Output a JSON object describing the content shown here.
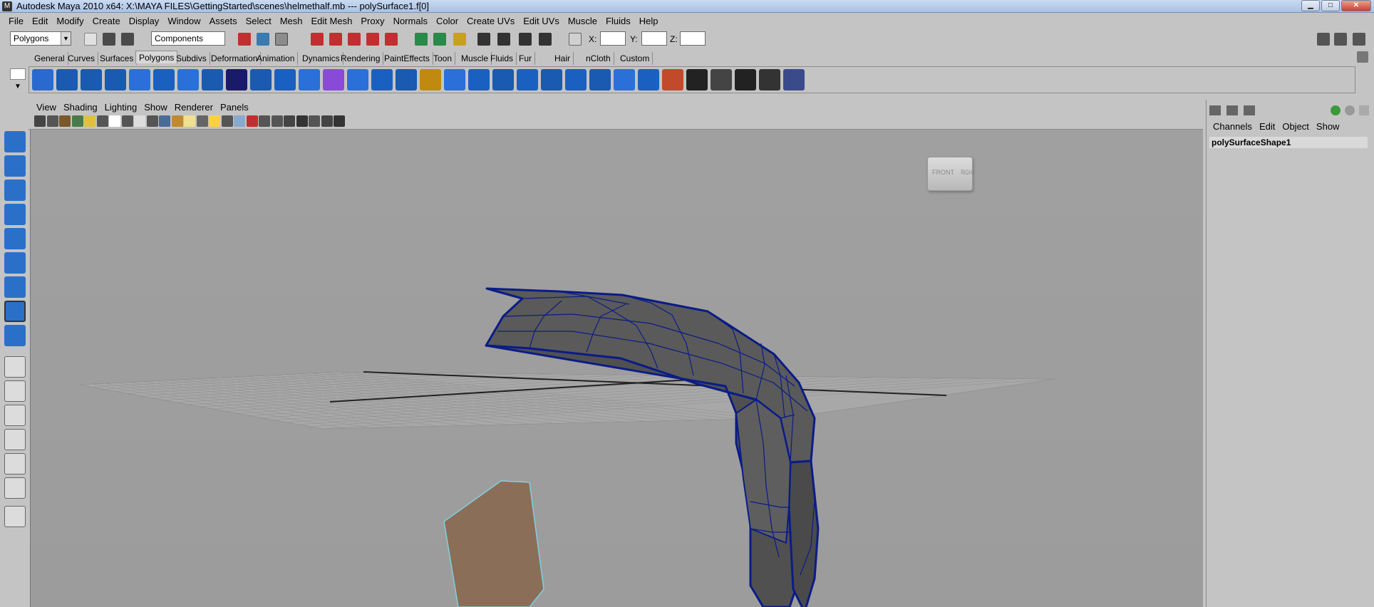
{
  "window": {
    "title": "Autodesk Maya 2010 x64: X:\\MAYA FILES\\GettingStarted\\scenes\\helmethalf.mb   ---   polySurface1.f[0]",
    "app_icon": "maya-icon",
    "buttons": [
      "minimize",
      "maximize",
      "close"
    ],
    "button_glyphs": [
      "▁",
      "□",
      "✕"
    ]
  },
  "menubar": [
    "File",
    "Edit",
    "Modify",
    "Create",
    "Display",
    "Window",
    "Assets",
    "Select",
    "Mesh",
    "Edit Mesh",
    "Proxy",
    "Normals",
    "Color",
    "Create UVs",
    "Edit UVs",
    "Muscle",
    "Fluids",
    "Help"
  ],
  "statusline": {
    "menuset": "Polygons",
    "selection_mode": "Components",
    "x_label": "X:",
    "y_label": "Y:",
    "z_label": "Z:",
    "x_value": "",
    "y_value": "",
    "z_value": ""
  },
  "shelf_tabs": [
    "General",
    "Curves",
    "Surfaces",
    "Polygons",
    "Subdivs",
    "Deformation",
    "Animation",
    "Dynamics",
    "Rendering",
    "PaintEffects",
    "Toon",
    "Muscle",
    "Fluids",
    "Fur",
    "Hair",
    "nCloth",
    "Custom"
  ],
  "active_shelf_tab": "Polygons",
  "panel_menu": [
    "View",
    "Shading",
    "Lighting",
    "Show",
    "Renderer",
    "Panels"
  ],
  "viewcube": {
    "front": "FRONT",
    "right": "RIGHT"
  },
  "channel_box": {
    "menu": [
      "Channels",
      "Edit",
      "Object",
      "Show"
    ],
    "object_name": "polySurfaceShape1"
  },
  "colors": {
    "ui_gray": "#c4c4c4",
    "viewport": "#9f9f9f",
    "wire": "#0a1a7a",
    "selected_face": "#8a6a50"
  }
}
